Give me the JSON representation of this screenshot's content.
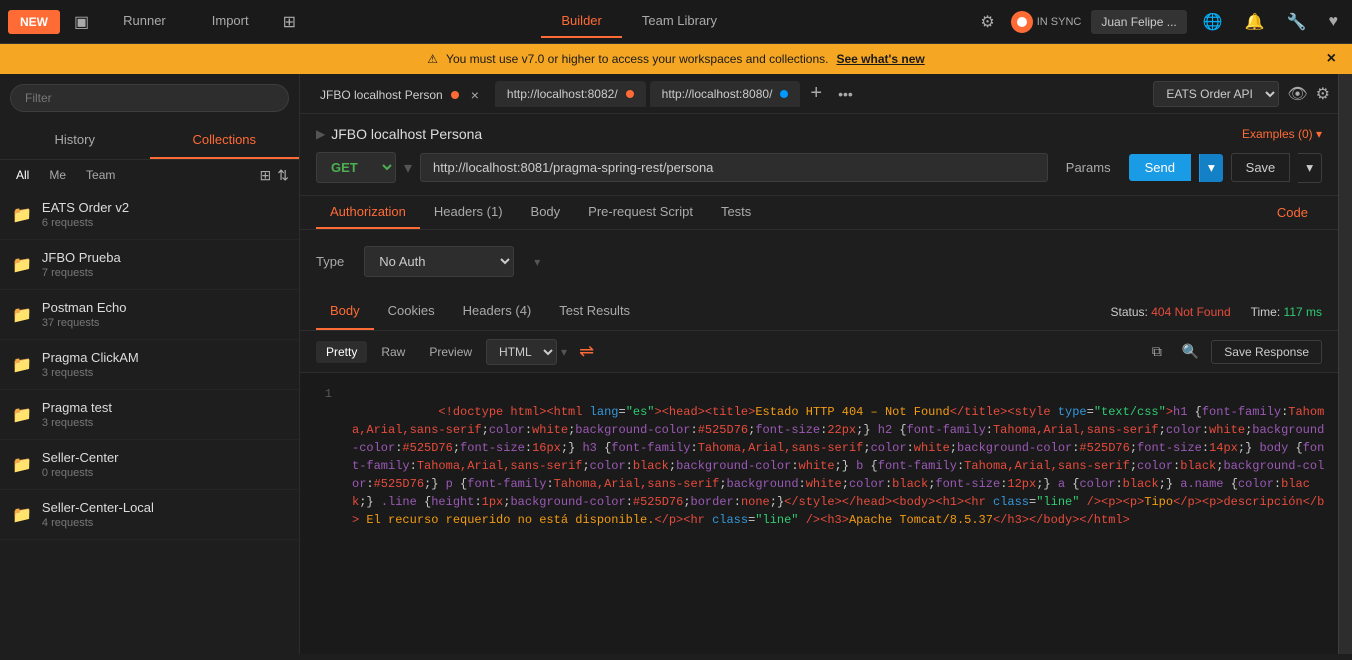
{
  "topbar": {
    "new_label": "NEW",
    "runner_label": "Runner",
    "import_label": "Import",
    "builder_label": "Builder",
    "team_library_label": "Team Library",
    "sync_text": "IN SYNC",
    "user_label": "Juan Felipe ...",
    "env_dropdown": "EATS Order API"
  },
  "banner": {
    "icon": "⚠",
    "message": "You must use v7.0 or higher to access your workspaces and collections.",
    "link_text": "See what's new"
  },
  "sidebar": {
    "search_placeholder": "Filter",
    "tabs": [
      "History",
      "Collections"
    ],
    "active_tab": "Collections",
    "filters": [
      "All",
      "Me",
      "Team"
    ],
    "active_filter": "All",
    "items": [
      {
        "name": "EATS Order v2",
        "requests": "6 requests"
      },
      {
        "name": "JFBO Prueba",
        "requests": "7 requests"
      },
      {
        "name": "Postman Echo",
        "requests": "37 requests"
      },
      {
        "name": "Pragma ClickAM",
        "requests": "3 requests"
      },
      {
        "name": "Pragma test",
        "requests": "3 requests"
      },
      {
        "name": "Seller-Center",
        "requests": "0 requests"
      },
      {
        "name": "Seller-Center-Local",
        "requests": "4 requests"
      }
    ]
  },
  "request_tabs": [
    {
      "label": "JFBO localhost Person",
      "dot_color": "orange",
      "active": true
    },
    {
      "label": "http://localhost:8082/",
      "dot_color": "orange",
      "active": false
    },
    {
      "label": "http://localhost:8080/",
      "dot_color": "blue",
      "active": false
    }
  ],
  "request": {
    "title": "JFBO localhost Persona",
    "examples_label": "Examples (0)",
    "method": "GET",
    "url": "http://localhost:8081/pragma-spring-rest/persona",
    "params_label": "Params",
    "send_label": "Send",
    "save_label": "Save"
  },
  "request_inner_tabs": {
    "tabs": [
      "Authorization",
      "Headers (1)",
      "Body",
      "Pre-request Script",
      "Tests"
    ],
    "active_tab": "Authorization",
    "code_label": "Code"
  },
  "auth": {
    "type_label": "Type",
    "type_value": "No Auth"
  },
  "response": {
    "tabs": [
      "Body",
      "Cookies",
      "Headers (4)",
      "Test Results"
    ],
    "active_tab": "Body",
    "status_label": "Status:",
    "status_value": "404 Not Found",
    "time_label": "Time:",
    "time_value": "117 ms",
    "body_formats": [
      "Pretty",
      "Raw",
      "Preview"
    ],
    "active_format": "Pretty",
    "lang": "HTML",
    "save_response_label": "Save Response",
    "code_content": "<!doctype html><html lang=\"es\"><head><title>Estado HTTP 404 – Not Found</title><style type=\"text/css\">h1 {font-family:Tahoma,Arial,sans-serif;color:white;background-color:#525D76;font-size:22px;} h2 {font-family:Tahoma,Arial,sans-serif;color:white;background-color:#525D76;font-size:16px;} h3 {font-family:Tahoma,Arial,sans-serif;color:white;background-color:#525D76;font-size:14px;} body {font-family:Tahoma,Arial,sans-serif;color:black;background-color:white;} b {font-family:Tahoma,Arial,sans-serif;color:black;background-color:#525D76;} p {font-family:Tahoma,Arial,sans-serif;background:white;color:black;font-size:12px;} a {color:black;} a.name {color:black;} .line {height:1px;background-color:#525D76;border:none;}</style></head><body><h1><hr class=\"line\" /><p><p>Tipo</p><p>Descripción</b> El recurso requerido no está disponible.</p><hr class=\"line\" /><h3>Apache Tomcat/8.5.37</h3></body></html>"
  }
}
